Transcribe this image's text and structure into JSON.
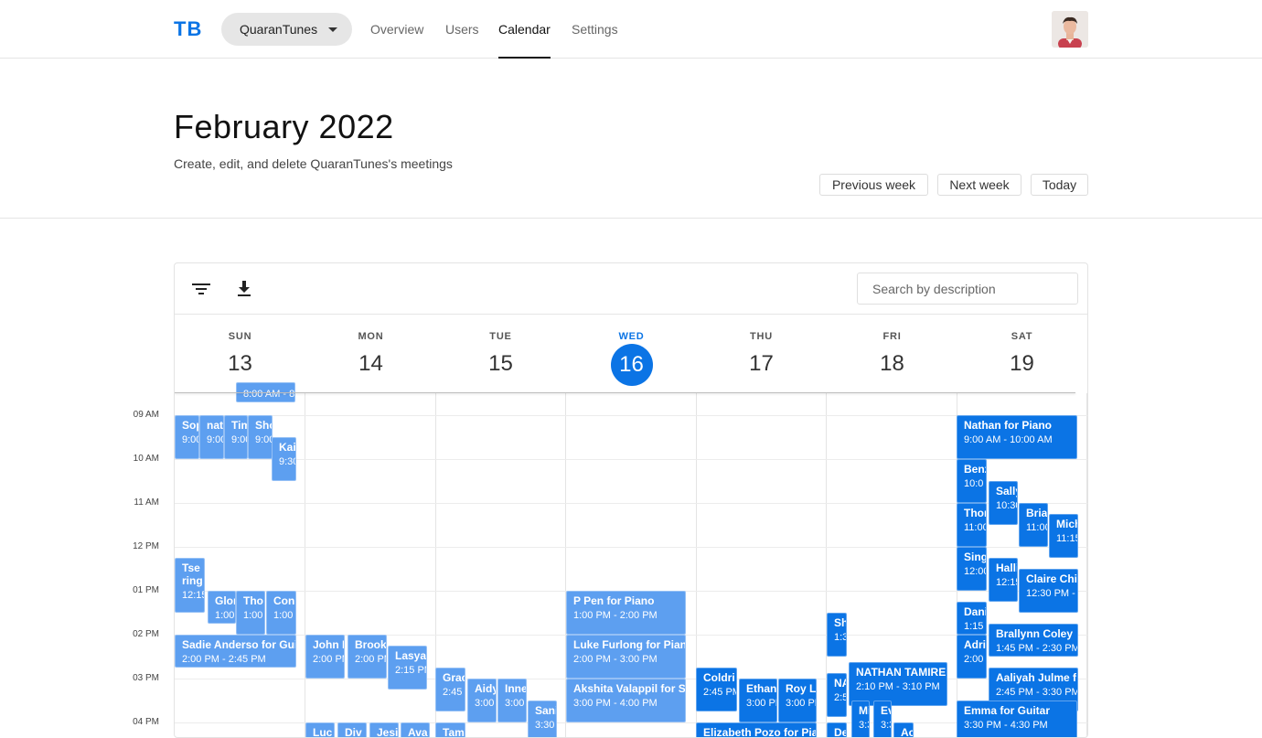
{
  "nav": {
    "logo": "TB",
    "team": "QuaranTunes",
    "tabs": [
      {
        "label": "Overview",
        "active": false
      },
      {
        "label": "Users",
        "active": false
      },
      {
        "label": "Calendar",
        "active": true
      },
      {
        "label": "Settings",
        "active": false
      }
    ]
  },
  "header": {
    "title": "February 2022",
    "subtitle": "Create, edit, and delete QuaranTunes's meetings",
    "prev_week": "Previous week",
    "next_week": "Next week",
    "today": "Today"
  },
  "toolbar": {
    "filter_icon": "filter-icon",
    "download_icon": "download-icon",
    "search_placeholder": "Search by description"
  },
  "days": [
    {
      "dow": "SUN",
      "num": "13",
      "today": false
    },
    {
      "dow": "MON",
      "num": "14",
      "today": false
    },
    {
      "dow": "TUE",
      "num": "15",
      "today": false
    },
    {
      "dow": "WED",
      "num": "16",
      "today": true
    },
    {
      "dow": "THU",
      "num": "17",
      "today": false
    },
    {
      "dow": "FRI",
      "num": "18",
      "today": false
    },
    {
      "dow": "SAT",
      "num": "19",
      "today": false
    }
  ],
  "time_labels": [
    "09 AM",
    "10 AM",
    "11 AM",
    "12 PM",
    "01 PM",
    "02 PM",
    "03 PM",
    "04 PM"
  ],
  "colors": {
    "accent": "#0b74e5",
    "event_light": "#5d9ff0"
  },
  "events": [
    {
      "day": 0,
      "title": "",
      "time": "8:00 AM - 8",
      "style": "light"
    },
    {
      "day": 0,
      "title": "Sop",
      "time": "9:00",
      "style": "light"
    },
    {
      "day": 0,
      "title": "nat",
      "time": "9:00",
      "style": "light"
    },
    {
      "day": 0,
      "title": "Tim",
      "time": "9:00",
      "style": "light"
    },
    {
      "day": 0,
      "title": "Sho",
      "time": "9:00",
      "style": "light"
    },
    {
      "day": 0,
      "title": "Kai",
      "time": "9:30",
      "style": "light"
    },
    {
      "day": 0,
      "title": "Tse ring",
      "time": "12:15",
      "style": "light"
    },
    {
      "day": 0,
      "title": "Glor",
      "time": "1:00",
      "style": "light"
    },
    {
      "day": 0,
      "title": "Tho",
      "time": "1:00",
      "style": "light"
    },
    {
      "day": 0,
      "title": "Con",
      "time": "1:00",
      "style": "light"
    },
    {
      "day": 0,
      "title": "Sadie Anderso for Gui",
      "time": "2:00 PM - 2:45 PM",
      "style": "light"
    },
    {
      "day": 1,
      "title": "John K",
      "time": "2:00 PM",
      "style": "light"
    },
    {
      "day": 1,
      "title": "Brook",
      "time": "2:00 PM",
      "style": "light"
    },
    {
      "day": 1,
      "title": "Lasya",
      "time": "2:15 PM",
      "style": "light"
    },
    {
      "day": 1,
      "title": "Luc",
      "time": "",
      "style": "light"
    },
    {
      "day": 1,
      "title": "Div",
      "time": "",
      "style": "light"
    },
    {
      "day": 1,
      "title": "Jesi",
      "time": "",
      "style": "light"
    },
    {
      "day": 1,
      "title": "Ava",
      "time": "",
      "style": "light"
    },
    {
      "day": 2,
      "title": "Grac",
      "time": "2:45 I",
      "style": "light"
    },
    {
      "day": 2,
      "title": "Aidy",
      "time": "3:00",
      "style": "light"
    },
    {
      "day": 2,
      "title": "Inne",
      "time": "3:00",
      "style": "light"
    },
    {
      "day": 2,
      "title": "Sani",
      "time": "3:30",
      "style": "light"
    },
    {
      "day": 2,
      "title": "Tam",
      "time": "",
      "style": "light"
    },
    {
      "day": 3,
      "title": "P Pen for Piano",
      "time": "1:00 PM - 2:00 PM",
      "style": "light"
    },
    {
      "day": 3,
      "title": "Luke Furlong for Pian",
      "time": "2:00 PM - 3:00 PM",
      "style": "light"
    },
    {
      "day": 3,
      "title": "Akshita Valappil for S",
      "time": "3:00 PM - 4:00 PM",
      "style": "light"
    },
    {
      "day": 4,
      "title": "Coldri",
      "time": "2:45 PM",
      "style": "dark"
    },
    {
      "day": 4,
      "title": "Ethan",
      "time": "3:00 PM",
      "style": "dark"
    },
    {
      "day": 4,
      "title": "Roy L",
      "time": "3:00 PM",
      "style": "dark"
    },
    {
      "day": 4,
      "title": "Elizabeth Pozo for Pia",
      "time": "",
      "style": "dark"
    },
    {
      "day": 5,
      "title": "Sh",
      "time": "1:3",
      "style": "dark"
    },
    {
      "day": 5,
      "title": "NATHAN TAMIRE",
      "time": "2:10 PM - 3:10 PM",
      "style": "dark"
    },
    {
      "day": 5,
      "title": "NA",
      "time": "2:5",
      "style": "dark"
    },
    {
      "day": 5,
      "title": "Mi",
      "time": "3:3",
      "style": "dark"
    },
    {
      "day": 5,
      "title": "Ev",
      "time": "3:3",
      "style": "dark"
    },
    {
      "day": 5,
      "title": "Ac",
      "time": "",
      "style": "dark"
    },
    {
      "day": 5,
      "title": "De",
      "time": "",
      "style": "dark"
    },
    {
      "day": 6,
      "title": "Nathan for Piano",
      "time": "9:00 AM - 10:00 AM",
      "style": "dark"
    },
    {
      "day": 6,
      "title": "Benz",
      "time": "10:0",
      "style": "dark"
    },
    {
      "day": 6,
      "title": "Sally",
      "time": "10:30",
      "style": "dark"
    },
    {
      "day": 6,
      "title": "Thor",
      "time": "11:00",
      "style": "dark"
    },
    {
      "day": 6,
      "title": "Bria",
      "time": "11:00",
      "style": "dark"
    },
    {
      "day": 6,
      "title": "Mich",
      "time": "11:15",
      "style": "dark"
    },
    {
      "day": 6,
      "title": "Sing",
      "time": "12:00",
      "style": "dark"
    },
    {
      "day": 6,
      "title": "Halli",
      "time": "12:15",
      "style": "dark"
    },
    {
      "day": 6,
      "title": "Claire Chi",
      "time": "12:30 PM -",
      "style": "dark"
    },
    {
      "day": 6,
      "title": "Dani",
      "time": "1:15 P",
      "style": "dark"
    },
    {
      "day": 6,
      "title": "Brallynn Coley",
      "time": "1:45 PM - 2:30 PM",
      "style": "dark"
    },
    {
      "day": 6,
      "title": "Adria",
      "time": "2:00",
      "style": "dark"
    },
    {
      "day": 6,
      "title": "Aaliyah Julme f",
      "time": "2:45 PM - 3:30 PM",
      "style": "dark"
    },
    {
      "day": 6,
      "title": "Emma for Guitar",
      "time": "3:30 PM - 4:30 PM",
      "style": "dark"
    }
  ]
}
